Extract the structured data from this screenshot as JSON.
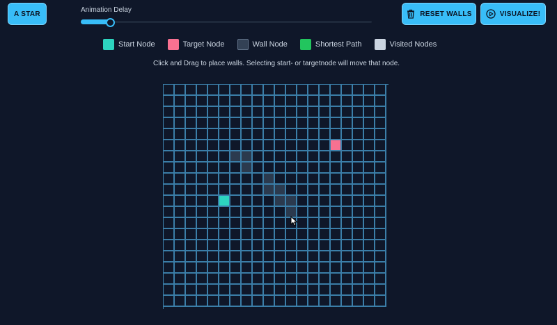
{
  "toolbar": {
    "algorithm_label": "A STAR",
    "delay_label": "Animation Delay",
    "delay_fraction": 0.1,
    "reset_label": "RESET WALLS",
    "visualize_label": "VISUALIZE!"
  },
  "legend": [
    {
      "label": "Start Node",
      "color": "#2dd4bf",
      "border": "#2dd4bf"
    },
    {
      "label": "Target Node",
      "color": "#f87191",
      "border": "#f87191"
    },
    {
      "label": "Wall Node",
      "color": "#334155",
      "border": "#64748b"
    },
    {
      "label": "Shortest Path",
      "color": "#22c55e",
      "border": "#22c55e"
    },
    {
      "label": "Visited Nodes",
      "color": "#cbd5e1",
      "border": "#cbd5e1"
    }
  ],
  "instructions": "Click and Drag to place walls. Selecting start- or targetnode will move that node.",
  "grid": {
    "rows": 20,
    "cols": 20,
    "start": [
      10,
      5
    ],
    "target": [
      5,
      15
    ],
    "shaded": [
      [
        6,
        6
      ],
      [
        6,
        7
      ],
      [
        7,
        7
      ],
      [
        8,
        9
      ],
      [
        9,
        9
      ],
      [
        9,
        10
      ],
      [
        10,
        10
      ],
      [
        10,
        11
      ],
      [
        11,
        11
      ]
    ]
  },
  "colors": {
    "accent": "#38bdf8",
    "background": "#0f1729",
    "grid_line": "#3b7ea8"
  }
}
